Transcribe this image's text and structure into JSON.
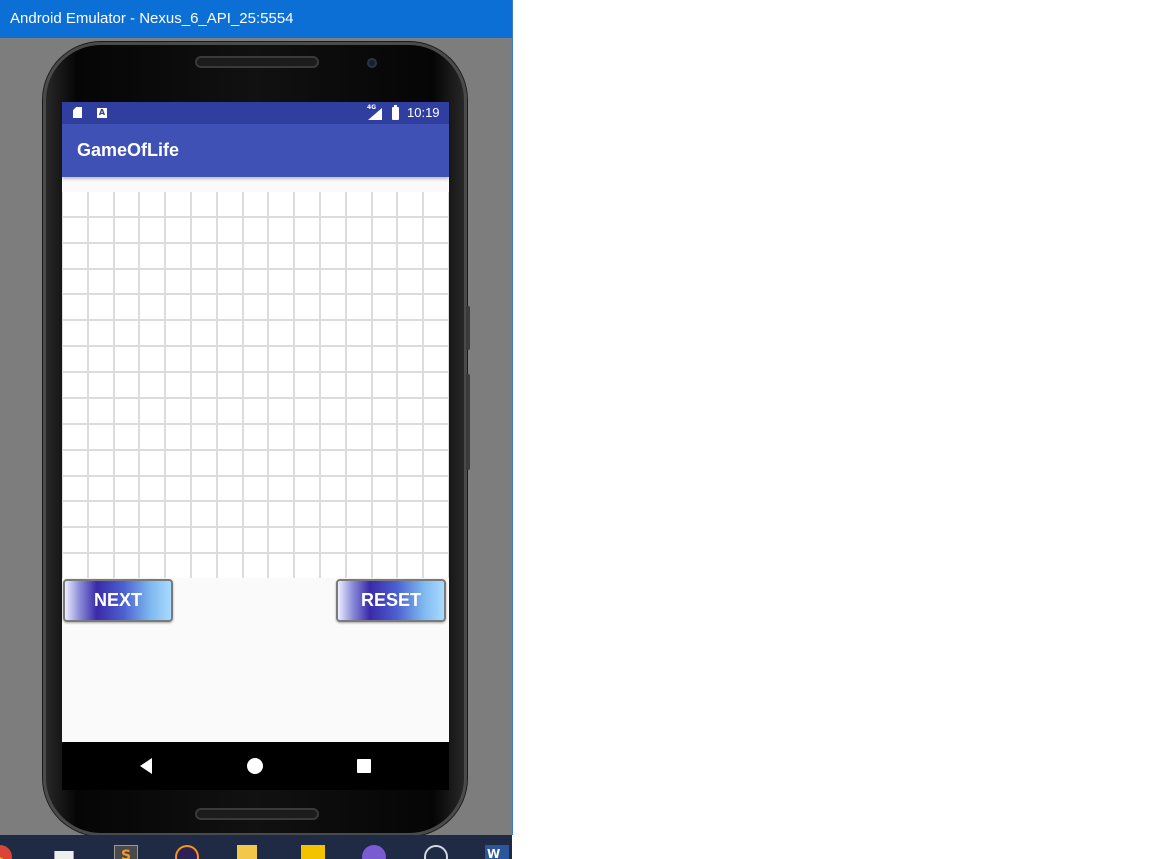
{
  "window": {
    "title": "Android Emulator - Nexus_6_API_25:5554"
  },
  "status_bar": {
    "network": "4G",
    "time": "10:19",
    "icons": [
      "sd-card-icon",
      "a-notification-icon",
      "signal-icon",
      "battery-icon"
    ]
  },
  "app_bar": {
    "title": "GameOfLife"
  },
  "board": {
    "columns": 15,
    "rows": 15,
    "live_cells": []
  },
  "controls": {
    "next_label": "NEXT",
    "reset_label": "RESET"
  },
  "nav_bar": {
    "icons": [
      "back-icon",
      "home-icon",
      "recents-icon"
    ]
  },
  "taskbar": {
    "icons": [
      "chrome-icon",
      "store-icon",
      "sublime-text-icon",
      "eclipse-icon",
      "folder-icon",
      "search-app-icon",
      "github-icon",
      "settings-app-icon",
      "word-icon"
    ],
    "sublime_glyph": "S",
    "word_glyph": "W"
  },
  "colors": {
    "status_bar": "#303f9f",
    "app_bar": "#3f51b5",
    "titlebar": "#0b6fd6",
    "grid_line": "#dcdcdc"
  }
}
